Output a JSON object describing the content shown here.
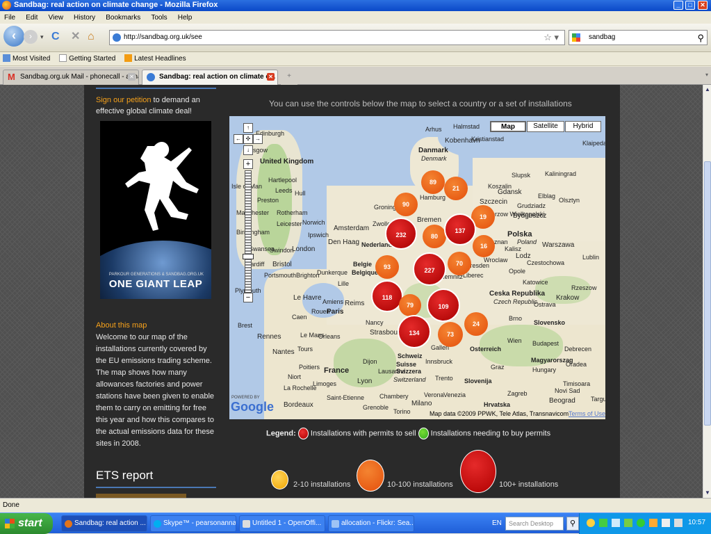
{
  "window": {
    "title": "Sandbag: real action on climate change - Mozilla Firefox"
  },
  "menu": {
    "items": [
      "File",
      "Edit",
      "View",
      "History",
      "Bookmarks",
      "Tools",
      "Help"
    ]
  },
  "nav": {
    "url": "http://sandbag.org.uk/see",
    "search_value": "sandbag"
  },
  "bookmarks": {
    "items": [
      "Most Visited",
      "Getting Started",
      "Latest Headlines"
    ]
  },
  "tabs": [
    {
      "label": "Sandbag.org.uk Mail - phonecall - anna..."
    },
    {
      "label": "Sandbag: real action on climate c..."
    },
    {
      "label": "+"
    }
  ],
  "sidebar": {
    "petition_link": "Sign our petition",
    "petition_text": " to demand an effective global climate deal!",
    "poster_small": "PARKOUR GENERATIONS & SANDBAG.ORG.UK",
    "poster_title": "ONE GIANT LEAP",
    "about_title": "About this map",
    "about_text": "Welcome to our map of the installations currently covered by the EU emissions trading scheme. The map shows how many allowances factories and power stations have been given to enable them to carry on emitting for free this year and how this compares to the actual emissions data for these sites in 2008.",
    "ets_title": "ETS report"
  },
  "main": {
    "heading": "You can use the controls below the map to select a country or a set of installations"
  },
  "map": {
    "types": [
      "Map",
      "Satellite",
      "Hybrid"
    ],
    "selected_type": "Map",
    "powered_by": "POWERED BY",
    "google": "Google",
    "attribution": "Map data ©2009 PPWK, Tele Atlas, Transnavicom",
    "terms": "Terms of Use",
    "places": [
      "Edinburgh",
      "Glasgow",
      "United Kingdom",
      "Isle of Man",
      "Hartlepool",
      "Leeds",
      "Hull",
      "Preston",
      "Manchester",
      "Rotherham",
      "Norwich",
      "Birmingham",
      "Leicester",
      "Ipswich",
      "Swansea",
      "Swindon",
      "London",
      "Cardiff",
      "Bristol",
      "Portsmouth",
      "Brighton",
      "Plymouth",
      "Amsterdam",
      "Den Haag",
      "Nederland",
      "Belgie",
      "Belgique",
      "Lille",
      "Dunkerque",
      "Brest",
      "Rennes",
      "Le Havre",
      "Rouen",
      "Paris",
      "Reims",
      "Amiens",
      "Caen",
      "Nantes",
      "Le Mans",
      "Orleans",
      "Tours",
      "Poitiers",
      "Niort",
      "La Rochelle",
      "Limoges",
      "France",
      "Dijon",
      "Nancy",
      "Strasbourg",
      "Lyon",
      "Bordeaux",
      "Saint-Etienne",
      "Grenoble",
      "Chambery",
      "Torino",
      "Milano",
      "Verona",
      "Venezia",
      "Trento",
      "Innsbruck",
      "Schweiz",
      "Suisse",
      "Svizzera",
      "Lausanne",
      "Switzerland",
      "Gallen",
      "Osterreich",
      "Wien",
      "Graz",
      "Slovenija",
      "Zagreb",
      "Hrvatska",
      "Budapest",
      "Magyarorszag",
      "Hungary",
      "Slovensko",
      "Brno",
      "Ostrava",
      "Krakow",
      "Katowice",
      "Opole",
      "Czestochowa",
      "Wroclaw",
      "Poznan",
      "Polska",
      "Poland",
      "Lodz",
      "Warszawa",
      "Lublin",
      "Kalisz",
      "Gdansk",
      "Elblag",
      "Olsztyn",
      "Bydgoszcz",
      "Grudziadz",
      "Gorzow Wielkopolski",
      "Koszalin",
      "Slupsk",
      "Kaliningrad",
      "Klaipeda",
      "Danmark",
      "Denmark",
      "Kobenhavn",
      "Kristianstad",
      "Halmstad",
      "Arhus",
      "Hamburg",
      "Bremen",
      "Groningen",
      "Zwolle",
      "Szczecin",
      "Dresden",
      "Chemnitz",
      "Liberec",
      "Ceska Republika",
      "Czech Republic",
      "Rzeszow",
      "Debrecen",
      "Oradea",
      "Novi Sad",
      "Beograd",
      "Timisoara",
      "Targu"
    ],
    "bubbles": [
      {
        "value": "89",
        "size": "medium"
      },
      {
        "value": "21",
        "size": "medium"
      },
      {
        "value": "90",
        "size": "medium"
      },
      {
        "value": "19",
        "size": "medium"
      },
      {
        "value": "232",
        "size": "large"
      },
      {
        "value": "80",
        "size": "medium"
      },
      {
        "value": "137",
        "size": "large"
      },
      {
        "value": "16",
        "size": "medium"
      },
      {
        "value": "93",
        "size": "medium"
      },
      {
        "value": "227",
        "size": "large"
      },
      {
        "value": "70",
        "size": "medium"
      },
      {
        "value": "118",
        "size": "large"
      },
      {
        "value": "79",
        "size": "medium"
      },
      {
        "value": "109",
        "size": "large"
      },
      {
        "value": "24",
        "size": "medium"
      },
      {
        "value": "134",
        "size": "large"
      },
      {
        "value": "73",
        "size": "medium"
      }
    ]
  },
  "legend": {
    "label": "Legend:",
    "sell_text": "Installations with permits to sell",
    "buy_text": "Installations needing to buy permits",
    "sell_color": "#cc0000",
    "buy_color": "#44aa22",
    "small": "2-10 installations",
    "medium": "10-100 installations",
    "large": "100+ installations"
  },
  "status": {
    "text": "Done"
  },
  "taskbar": {
    "start": "start",
    "tasks": [
      "Sandbag: real action ...",
      "Skype™ - pearsonanna",
      "Untitled 1 - OpenOffi...",
      "allocation - Flickr: Sea..."
    ],
    "lang": "EN",
    "search_placeholder": "Search Desktop",
    "time": "10:57"
  }
}
